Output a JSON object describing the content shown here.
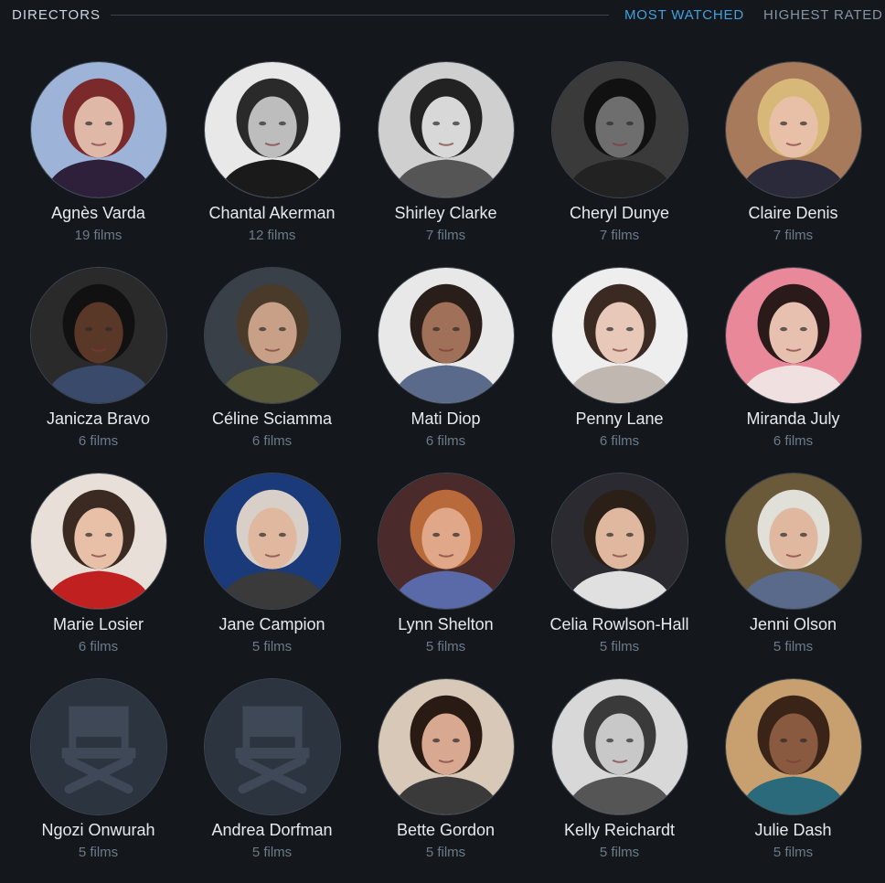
{
  "header": {
    "title": "DIRECTORS",
    "tabs": [
      {
        "label": "MOST WATCHED",
        "active": true
      },
      {
        "label": "HIGHEST RATED",
        "active": false
      }
    ]
  },
  "directors": [
    {
      "name": "Agnès Varda",
      "films": "19 films",
      "photo": "portrait",
      "palette": [
        "#9db3d8",
        "#7a2a2a",
        "#e0b8a8",
        "#2e1f3a"
      ]
    },
    {
      "name": "Chantal Akerman",
      "films": "12 films",
      "photo": "portrait",
      "palette": [
        "#e8e8e8",
        "#2a2a2a",
        "#bdbdbd",
        "#1a1a1a"
      ]
    },
    {
      "name": "Shirley Clarke",
      "films": "7 films",
      "photo": "portrait",
      "palette": [
        "#cfcfcf",
        "#222222",
        "#d8d8d8",
        "#555555"
      ]
    },
    {
      "name": "Cheryl Dunye",
      "films": "7 films",
      "photo": "portrait",
      "palette": [
        "#3a3a3a",
        "#111111",
        "#6e6e6e",
        "#222222"
      ]
    },
    {
      "name": "Claire Denis",
      "films": "7 films",
      "photo": "portrait",
      "palette": [
        "#a67a5a",
        "#d8b878",
        "#e8c0a8",
        "#2a2a3a"
      ]
    },
    {
      "name": "Janicza Bravo",
      "films": "6 films",
      "photo": "portrait",
      "palette": [
        "#2a2a2a",
        "#111111",
        "#5a3828",
        "#3a4a6a"
      ]
    },
    {
      "name": "Céline Sciamma",
      "films": "6 films",
      "photo": "portrait",
      "palette": [
        "#3a4048",
        "#4a3a2a",
        "#c8a088",
        "#5a5a3a"
      ]
    },
    {
      "name": "Mati Diop",
      "films": "6 films",
      "photo": "portrait",
      "palette": [
        "#e8e8e8",
        "#2a1e1a",
        "#a07058",
        "#5a6a8a"
      ]
    },
    {
      "name": "Penny Lane",
      "films": "6 films",
      "photo": "portrait",
      "palette": [
        "#eeeeee",
        "#3a2a22",
        "#e8c8b8",
        "#c0b8b0"
      ]
    },
    {
      "name": "Miranda July",
      "films": "6 films",
      "photo": "portrait",
      "palette": [
        "#e88898",
        "#2a1a1a",
        "#e8c0b0",
        "#f0e0e0"
      ]
    },
    {
      "name": "Marie Losier",
      "films": "6 films",
      "photo": "portrait",
      "palette": [
        "#e8e0d8",
        "#3a2a22",
        "#e8c0a8",
        "#c02020"
      ]
    },
    {
      "name": "Jane Campion",
      "films": "5 films",
      "photo": "portrait",
      "palette": [
        "#1a3a7a",
        "#d8d0c8",
        "#e0b8a0",
        "#3a3a3a"
      ]
    },
    {
      "name": "Lynn Shelton",
      "films": "5 films",
      "photo": "portrait",
      "palette": [
        "#4a2a2a",
        "#b86a3a",
        "#e0a888",
        "#5a6aa8"
      ]
    },
    {
      "name": "Celia Rowlson-Hall",
      "films": "5 films",
      "photo": "portrait",
      "palette": [
        "#2a2a30",
        "#2a2018",
        "#e0b8a0",
        "#e0e0e0"
      ]
    },
    {
      "name": "Jenni Olson",
      "films": "5 films",
      "photo": "portrait",
      "palette": [
        "#6a5a3a",
        "#e0e0d8",
        "#e0b8a0",
        "#5a6a8a"
      ]
    },
    {
      "name": "Ngozi Onwurah",
      "films": "5 films",
      "photo": "placeholder",
      "palette": [
        "#2c3440",
        "#3e4856",
        "#3e4856",
        "#3e4856"
      ]
    },
    {
      "name": "Andrea Dorfman",
      "films": "5 films",
      "photo": "placeholder",
      "palette": [
        "#2c3440",
        "#3e4856",
        "#3e4856",
        "#3e4856"
      ]
    },
    {
      "name": "Bette Gordon",
      "films": "5 films",
      "photo": "portrait",
      "palette": [
        "#d8c8b8",
        "#2a1a14",
        "#d8a890",
        "#3a3a3a"
      ]
    },
    {
      "name": "Kelly Reichardt",
      "films": "5 films",
      "photo": "portrait",
      "palette": [
        "#d8d8d8",
        "#3a3a3a",
        "#c8c8c8",
        "#555555"
      ]
    },
    {
      "name": "Julie Dash",
      "films": "5 films",
      "photo": "portrait",
      "palette": [
        "#c8a070",
        "#3a2418",
        "#8a5a40",
        "#2a6a7a"
      ]
    }
  ]
}
